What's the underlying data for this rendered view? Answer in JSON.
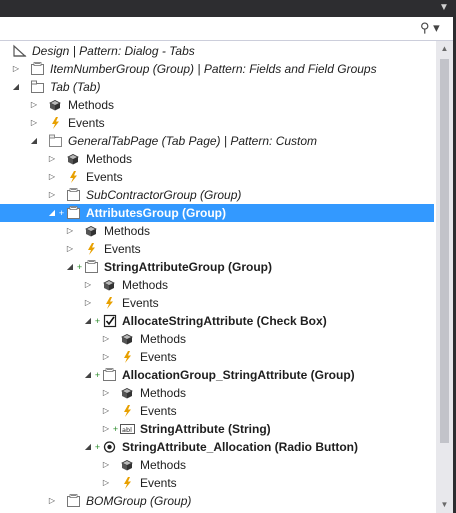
{
  "search": {
    "placeholder": "",
    "value": ""
  },
  "colors": {
    "selection": "#3399ff",
    "scrollbar_track": "#e8e8ec",
    "scrollbar_thumb": "#c2c3c9",
    "event_icon": "#e8a000",
    "plus": "#2a8a2a"
  },
  "tree": {
    "items": [
      {
        "label": "Design | Pattern: Dialog - Tabs",
        "level": 0,
        "expander": "none",
        "icon": "design-icon",
        "italic": true,
        "bold": false
      },
      {
        "label": "ItemNumberGroup (Group) | Pattern: Fields and Field Groups",
        "level": 1,
        "expander": "collapsed",
        "icon": "group-icon",
        "italic": true,
        "bold": false
      },
      {
        "label": "Tab (Tab)",
        "level": 1,
        "expander": "expanded",
        "icon": "tab-icon",
        "italic": true,
        "bold": false
      },
      {
        "label": "Methods",
        "level": 2,
        "expander": "collapsed",
        "icon": "methods-icon",
        "italic": false,
        "bold": false
      },
      {
        "label": "Events",
        "level": 2,
        "expander": "collapsed",
        "icon": "events-icon",
        "italic": false,
        "bold": false
      },
      {
        "label": "GeneralTabPage (Tab Page) | Pattern: Custom",
        "level": 2,
        "expander": "expanded",
        "icon": "tab-page-icon",
        "italic": true,
        "bold": false
      },
      {
        "label": "Methods",
        "level": 3,
        "expander": "collapsed",
        "icon": "methods-icon",
        "italic": false,
        "bold": false
      },
      {
        "label": "Events",
        "level": 3,
        "expander": "collapsed",
        "icon": "events-icon",
        "italic": false,
        "bold": false
      },
      {
        "label": "SubContractorGroup (Group)",
        "level": 3,
        "expander": "collapsed",
        "icon": "group-icon",
        "italic": true,
        "bold": false
      },
      {
        "label": "AttributesGroup (Group)",
        "level": 3,
        "expander": "expanded",
        "icon": "group-icon",
        "italic": false,
        "bold": true,
        "added": true,
        "selected": true
      },
      {
        "label": "Methods",
        "level": 4,
        "expander": "collapsed",
        "icon": "methods-icon",
        "italic": false,
        "bold": false
      },
      {
        "label": "Events",
        "level": 4,
        "expander": "collapsed",
        "icon": "events-icon",
        "italic": false,
        "bold": false
      },
      {
        "label": "StringAttributeGroup (Group)",
        "level": 4,
        "expander": "expanded",
        "icon": "group-icon",
        "italic": false,
        "bold": true,
        "added": true
      },
      {
        "label": "Methods",
        "level": 5,
        "expander": "collapsed",
        "icon": "methods-icon",
        "italic": false,
        "bold": false
      },
      {
        "label": "Events",
        "level": 5,
        "expander": "collapsed",
        "icon": "events-icon",
        "italic": false,
        "bold": false
      },
      {
        "label": "AllocateStringAttribute (Check Box)",
        "level": 5,
        "expander": "expanded",
        "icon": "checkbox-icon",
        "italic": false,
        "bold": true,
        "added": true
      },
      {
        "label": "Methods",
        "level": 6,
        "expander": "collapsed",
        "icon": "methods-icon",
        "italic": false,
        "bold": false
      },
      {
        "label": "Events",
        "level": 6,
        "expander": "collapsed",
        "icon": "events-icon",
        "italic": false,
        "bold": false
      },
      {
        "label": "AllocationGroup_StringAttribute (Group)",
        "level": 5,
        "expander": "expanded",
        "icon": "group-icon",
        "italic": false,
        "bold": true,
        "added": true
      },
      {
        "label": "Methods",
        "level": 6,
        "expander": "collapsed",
        "icon": "methods-icon",
        "italic": false,
        "bold": false
      },
      {
        "label": "Events",
        "level": 6,
        "expander": "collapsed",
        "icon": "events-icon",
        "italic": false,
        "bold": false
      },
      {
        "label": "StringAttribute (String)",
        "level": 6,
        "expander": "collapsed",
        "icon": "string-field-icon",
        "italic": false,
        "bold": true,
        "added": true
      },
      {
        "label": "StringAttribute_Allocation (Radio Button)",
        "level": 5,
        "expander": "expanded",
        "icon": "radio-button-icon",
        "italic": false,
        "bold": true,
        "added": true
      },
      {
        "label": "Methods",
        "level": 6,
        "expander": "collapsed",
        "icon": "methods-icon",
        "italic": false,
        "bold": false
      },
      {
        "label": "Events",
        "level": 6,
        "expander": "collapsed",
        "icon": "events-icon",
        "italic": false,
        "bold": false
      },
      {
        "label": "BOMGroup (Group)",
        "level": 3,
        "expander": "collapsed",
        "icon": "group-icon",
        "italic": true,
        "bold": false
      }
    ]
  }
}
